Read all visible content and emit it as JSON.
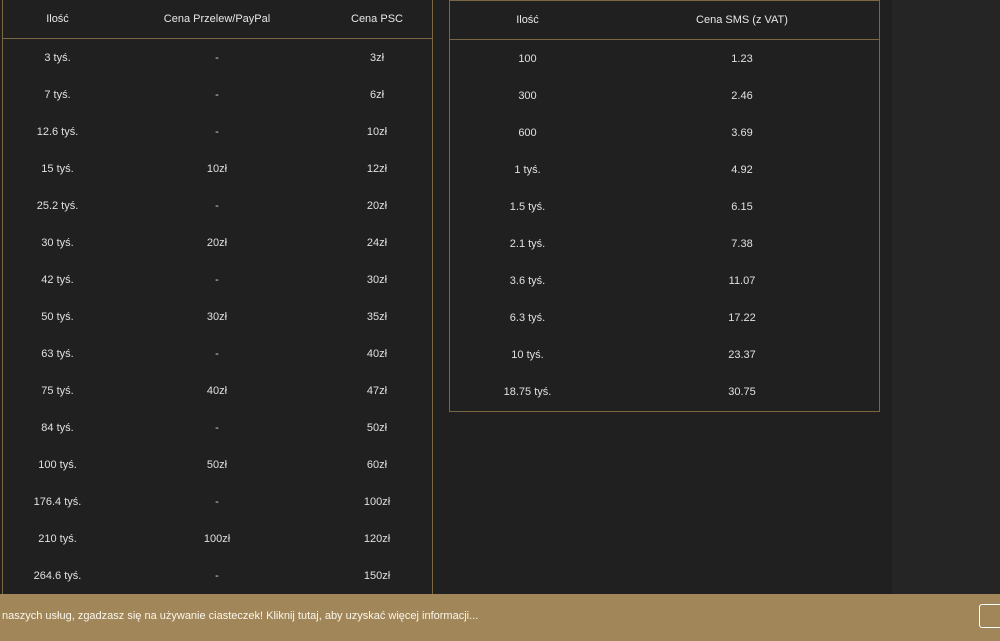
{
  "left_table": {
    "headers": [
      "Ilość",
      "Cena Przelew/PayPal",
      "Cena PSC"
    ],
    "rows": [
      [
        "3 tyś.",
        "-",
        "3zł"
      ],
      [
        "7 tyś.",
        "-",
        "6zł"
      ],
      [
        "12.6 tyś.",
        "-",
        "10zł"
      ],
      [
        "15 tyś.",
        "10zł",
        "12zł"
      ],
      [
        "25.2 tyś.",
        "-",
        "20zł"
      ],
      [
        "30 tyś.",
        "20zł",
        "24zł"
      ],
      [
        "42 tyś.",
        "-",
        "30zł"
      ],
      [
        "50 tyś.",
        "30zł",
        "35zł"
      ],
      [
        "63 tyś.",
        "-",
        "40zł"
      ],
      [
        "75 tyś.",
        "40zł",
        "47zł"
      ],
      [
        "84 tyś.",
        "-",
        "50zł"
      ],
      [
        "100 tyś.",
        "50zł",
        "60zł"
      ],
      [
        "176.4 tyś.",
        "-",
        "100zł"
      ],
      [
        "210 tyś.",
        "100zł",
        "120zł"
      ],
      [
        "264.6 tyś.",
        "-",
        "150zł"
      ]
    ]
  },
  "right_table": {
    "headers": [
      "Ilość",
      "Cena SMS (z VAT)"
    ],
    "rows": [
      [
        "100",
        "1.23"
      ],
      [
        "300",
        "2.46"
      ],
      [
        "600",
        "3.69"
      ],
      [
        "1 tyś.",
        "4.92"
      ],
      [
        "1.5 tyś.",
        "6.15"
      ],
      [
        "2.1 tyś.",
        "7.38"
      ],
      [
        "3.6 tyś.",
        "11.07"
      ],
      [
        "6.3 tyś.",
        "17.22"
      ],
      [
        "10 tyś.",
        "23.37"
      ],
      [
        "18.75 tyś.",
        "30.75"
      ]
    ]
  },
  "cookie_bar": {
    "text": "naszych usług, zgadzasz się na używanie ciasteczek! Kliknij tutaj, aby uzyskać więcej informacji..."
  }
}
